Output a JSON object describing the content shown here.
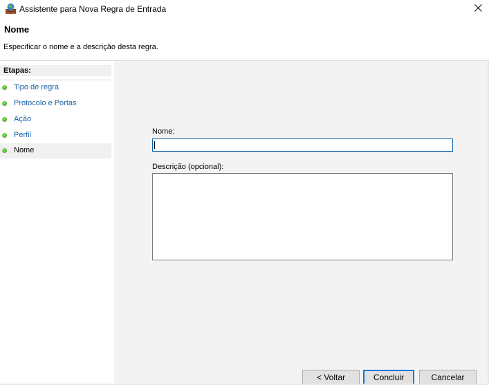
{
  "window": {
    "title": "Assistente para Nova Regra de Entrada",
    "app_icon": "firewall-wizard-icon",
    "close_icon": "close-icon"
  },
  "header": {
    "title": "Nome",
    "description": "Especificar o nome e a descrição desta regra."
  },
  "steps": {
    "title": "Etapas:",
    "items": [
      {
        "label": "Tipo de regra",
        "icon": "green-dot-icon"
      },
      {
        "label": "Protocolo e Portas",
        "icon": "green-dot-icon"
      },
      {
        "label": "Ação",
        "icon": "green-dot-icon"
      },
      {
        "label": "Perfil",
        "icon": "green-dot-icon"
      },
      {
        "label": "Nome",
        "icon": "green-dot-icon",
        "current": true
      }
    ]
  },
  "form": {
    "name_label": "Nome:",
    "name_value": "",
    "description_label": "Descrição (opcional):",
    "description_value": ""
  },
  "buttons": {
    "back": "< Voltar",
    "finish": "Concluir",
    "cancel": "Cancelar"
  },
  "colors": {
    "link": "#1a5fa8",
    "focus_border": "#0a64ad",
    "step_dot": "#3fae2a",
    "panel_bg": "#f3f3f3"
  }
}
